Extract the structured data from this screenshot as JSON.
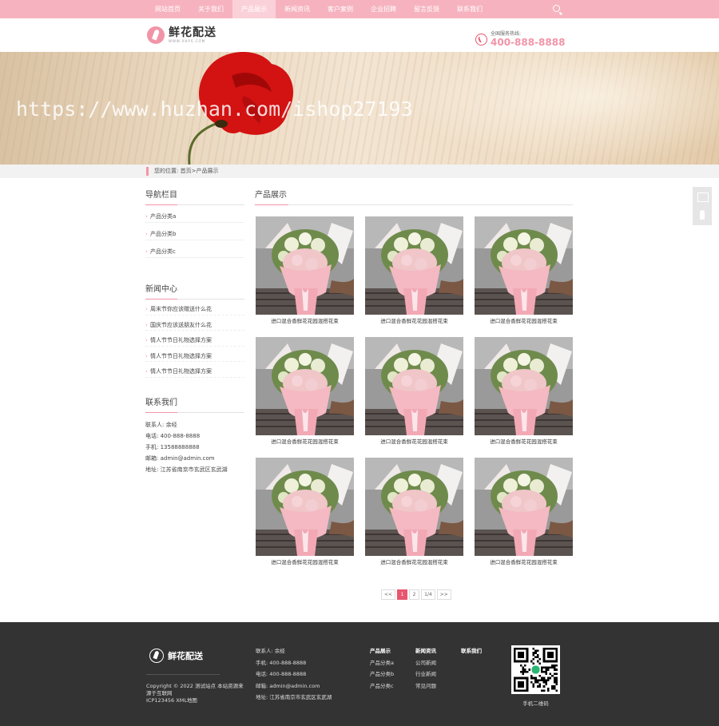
{
  "nav": {
    "items": [
      "网站首页",
      "关于我们",
      "产品展示",
      "新闻资讯",
      "客户案例",
      "企业招聘",
      "留言反馈",
      "联系我们"
    ],
    "active_index": 2
  },
  "header": {
    "logo_title": "鲜花配送",
    "logo_subtitle": "WWW.XHPS.COM",
    "hotline_label": "全国服务热线:",
    "hotline_number": "400-888-8888"
  },
  "banner": {
    "watermark": "https://www.huzhan.com/ishop27193"
  },
  "breadcrumb": {
    "text": "您的位置: 首页>产品展示"
  },
  "sidebar": {
    "nav_title": "导航栏目",
    "categories": [
      "产品分类a",
      "产品分类b",
      "产品分类c"
    ],
    "news_title": "新闻中心",
    "news": [
      "周末节你应该赠送什么花",
      "国庆节应该送朋友什么花",
      "情人节节日礼物选择方案",
      "情人节节日礼物选择方案",
      "情人节节日礼物选择方案"
    ],
    "contact_title": "联系我们",
    "contact": [
      "联系人: 余经",
      "电话: 400-888-8888",
      "手机: 13588888888",
      "邮箱: admin@admin.com",
      "地址: 江苏省南京市玄武区玄武湖"
    ]
  },
  "main": {
    "title": "产品展示",
    "products": [
      "进口混合香鲜花花园混搭花束",
      "进口混合香鲜花花园混搭花束",
      "进口混合香鲜花花园混搭花束",
      "进口混合香鲜花花园混搭花束",
      "进口混合香鲜花花园混搭花束",
      "进口混合香鲜花花园混搭花束",
      "进口混合香鲜花花园混搭花束",
      "进口混合香鲜花花园混搭花束",
      "进口混合香鲜花花园混搭花束"
    ]
  },
  "pagination": {
    "first": "<<",
    "pages": [
      "1",
      "2"
    ],
    "current": "1",
    "info": "1/4",
    "last": ">>"
  },
  "footer": {
    "logo_title": "鲜花配送",
    "copyright": "Copyright © 2022 测试站点 本站资源来源于互联网",
    "icp": "ICP123456 XML地图",
    "contact": [
      "联系人: 余经",
      "手机: 400-888-8888",
      "电话: 400-888-8888",
      "邮箱: admin@admin.com",
      "地址: 江苏省南京市玄武区玄武湖"
    ],
    "col1_title": "产品展示",
    "col1_items": [
      "产品分类a",
      "产品分类b",
      "产品分类c"
    ],
    "col2_title": "新闻资讯",
    "col2_items": [
      "公司新闻",
      "行业新闻",
      "常见问题"
    ],
    "col3_title": "联系我们",
    "col3_items": [],
    "qr_caption": "手机二维码"
  },
  "colors": {
    "brand_pink": "#f6b3bf",
    "accent_red": "#e8566f",
    "footer_bg": "#333333"
  },
  "icons": [
    "logo-flower-icon",
    "phone-icon",
    "search-icon",
    "qr-code-icon",
    "back-to-top-icon"
  ]
}
